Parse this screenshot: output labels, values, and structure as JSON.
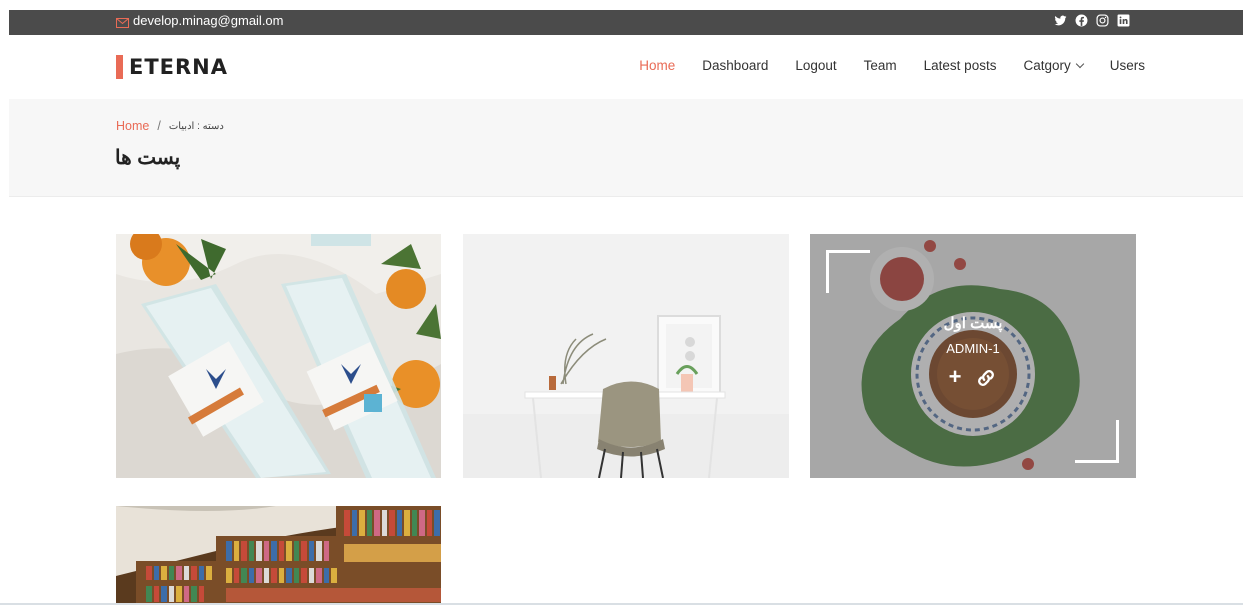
{
  "topbar": {
    "email": "develop.minag@gmail.om",
    "social_icons": [
      "twitter-icon",
      "facebook-icon",
      "instagram-icon",
      "linkedin-icon"
    ]
  },
  "brand": {
    "name": "ETERNA",
    "accent": "#e96b56"
  },
  "nav": {
    "items": [
      {
        "label": "Home",
        "active": true
      },
      {
        "label": "Dashboard"
      },
      {
        "label": "Logout"
      },
      {
        "label": "Team"
      },
      {
        "label": "Latest posts"
      },
      {
        "label": "Catgory",
        "dropdown": true
      },
      {
        "label": "Users"
      }
    ]
  },
  "breadcrumb": {
    "home": "Home",
    "separator": "/",
    "current": "دسته : ادبیات",
    "page_title": "پست ها"
  },
  "portfolio": {
    "items": [
      {
        "image": "water-bottles-and-oranges"
      },
      {
        "image": "white-desk-and-chair"
      },
      {
        "image": "tea-cup-with-berries",
        "title": "پست اول",
        "author": "ADMIN-1",
        "actions": [
          "+",
          "link-icon"
        ]
      },
      {
        "image": "library-bookshelves"
      }
    ]
  }
}
